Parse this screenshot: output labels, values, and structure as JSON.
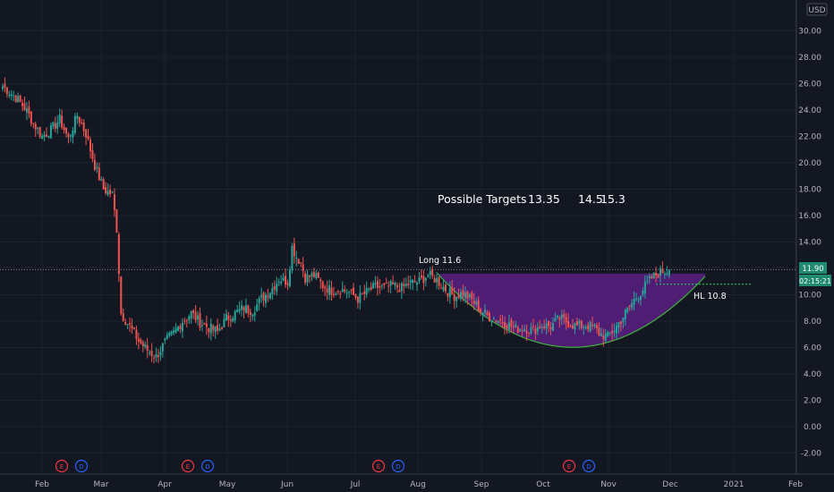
{
  "chart_data": {
    "type": "candlestick",
    "currency_label": "USD",
    "last_price": "11.90",
    "countdown": "02:15:21",
    "y_ticks": [
      "30.00",
      "28.00",
      "26.00",
      "24.00",
      "22.00",
      "20.00",
      "18.00",
      "16.00",
      "14.00",
      "12.00",
      "10.00",
      "8.00",
      "6.00",
      "4.00",
      "2.00",
      "0.00",
      "-2.00"
    ],
    "x_ticks": [
      "Feb",
      "Mar",
      "Apr",
      "May",
      "Jun",
      "Jul",
      "Aug",
      "Sep",
      "Oct",
      "Nov",
      "Dec",
      "2021",
      "Feb"
    ],
    "annotations": {
      "targets_label": "Possible Targets",
      "target1": "13.35",
      "target2": "14.5",
      "target3": "15.3",
      "long_label": "Long 11.6",
      "hl_label": "HL 10.8"
    },
    "events": [
      {
        "month": "Mar",
        "day": 0,
        "types": [
          "E",
          "D"
        ]
      },
      {
        "month": "May",
        "day": 0,
        "types": [
          "E",
          "D"
        ]
      },
      {
        "month": "Aug",
        "day": 0,
        "types": [
          "E",
          "D"
        ]
      },
      {
        "month": "Nov",
        "day": 0,
        "types": [
          "E",
          "D"
        ]
      }
    ],
    "close_path": [
      [
        0,
        25.8
      ],
      [
        5,
        25.1
      ],
      [
        10,
        24.2
      ],
      [
        14,
        23.0
      ],
      [
        18,
        22.0
      ],
      [
        22,
        22.5
      ],
      [
        26,
        23.3
      ],
      [
        30,
        21.8
      ],
      [
        34,
        23.6
      ],
      [
        38,
        22.2
      ],
      [
        42,
        19.8
      ],
      [
        46,
        18.0
      ],
      [
        50,
        17.6
      ],
      [
        52,
        15.0
      ],
      [
        54,
        8.6
      ],
      [
        58,
        7.6
      ],
      [
        62,
        6.5
      ],
      [
        66,
        5.8
      ],
      [
        70,
        5.3
      ],
      [
        74,
        6.4
      ],
      [
        78,
        7.1
      ],
      [
        82,
        8.0
      ],
      [
        86,
        8.6
      ],
      [
        90,
        7.9
      ],
      [
        94,
        7.5
      ],
      [
        98,
        7.2
      ],
      [
        102,
        8.2
      ],
      [
        106,
        8.6
      ],
      [
        110,
        9.0
      ],
      [
        114,
        8.8
      ],
      [
        118,
        9.7
      ],
      [
        122,
        10.3
      ],
      [
        126,
        11.2
      ],
      [
        130,
        11.0
      ],
      [
        132,
        13.6
      ],
      [
        134,
        12.9
      ],
      [
        136,
        12.4
      ],
      [
        138,
        11.3
      ],
      [
        142,
        11.5
      ],
      [
        146,
        10.7
      ],
      [
        150,
        10.3
      ],
      [
        154,
        10.4
      ],
      [
        158,
        10.2
      ],
      [
        162,
        9.7
      ],
      [
        166,
        10.2
      ],
      [
        170,
        10.6
      ],
      [
        174,
        10.5
      ],
      [
        178,
        10.7
      ],
      [
        182,
        10.5
      ],
      [
        186,
        10.9
      ],
      [
        190,
        11.0
      ],
      [
        194,
        11.5
      ],
      [
        198,
        11.1
      ],
      [
        202,
        10.4
      ],
      [
        206,
        9.9
      ],
      [
        210,
        10.1
      ],
      [
        214,
        9.6
      ],
      [
        218,
        8.8
      ],
      [
        222,
        8.3
      ],
      [
        226,
        8.1
      ],
      [
        230,
        7.8
      ],
      [
        234,
        7.4
      ],
      [
        238,
        7.5
      ],
      [
        242,
        7.3
      ],
      [
        246,
        7.7
      ],
      [
        250,
        7.6
      ],
      [
        254,
        8.2
      ],
      [
        258,
        7.9
      ],
      [
        262,
        7.6
      ],
      [
        266,
        7.7
      ],
      [
        270,
        7.5
      ],
      [
        272,
        7.1
      ],
      [
        276,
        6.8
      ],
      [
        280,
        7.6
      ],
      [
        284,
        8.6
      ],
      [
        288,
        9.6
      ],
      [
        292,
        10.4
      ],
      [
        296,
        11.3
      ],
      [
        300,
        11.7
      ],
      [
        304,
        11.9
      ]
    ],
    "series_meta": {
      "up_color": "#26a69a",
      "down_color": "#ef5350"
    },
    "pattern_colors": {
      "cup_fill": "#5b1f82",
      "cup_stroke": "#3cb43c",
      "hl_line": "#22c55e"
    }
  }
}
